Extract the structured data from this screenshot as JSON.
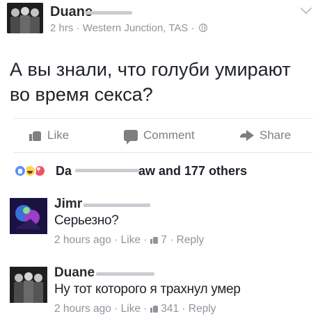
{
  "post": {
    "author": "Duane",
    "time": "2 hrs",
    "separator": "·",
    "location": "Western Junction, TAS",
    "privacy_icon": "globe-icon",
    "options_icon": "chevron-down-icon",
    "text": "А вы знали, что голуби умирают во время секса?"
  },
  "actions": {
    "like": "Like",
    "comment": "Comment",
    "share": "Share"
  },
  "reactions": {
    "icons": [
      "like-icon",
      "haha-icon",
      "love-icon"
    ],
    "names_prefix": "Da",
    "names_suffix": "aw and 177 others"
  },
  "comments": [
    {
      "author": "Jimr",
      "text": "Серьезно?",
      "time": "2 hours ago",
      "like_label": "Like",
      "like_count": "7",
      "reply_label": "Reply"
    },
    {
      "author": "Duane",
      "text": "Ну тот которого я трахнул умер",
      "time": "2 hours ago",
      "like_label": "Like",
      "like_count": "341",
      "reply_label": "Reply"
    }
  ],
  "colors": {
    "text": "#1d2129",
    "meta": "#90949c",
    "action": "#7f7f7f",
    "like_blue": "#5890ff",
    "haha_yellow": "#ffd254",
    "love_red": "#f25268"
  }
}
